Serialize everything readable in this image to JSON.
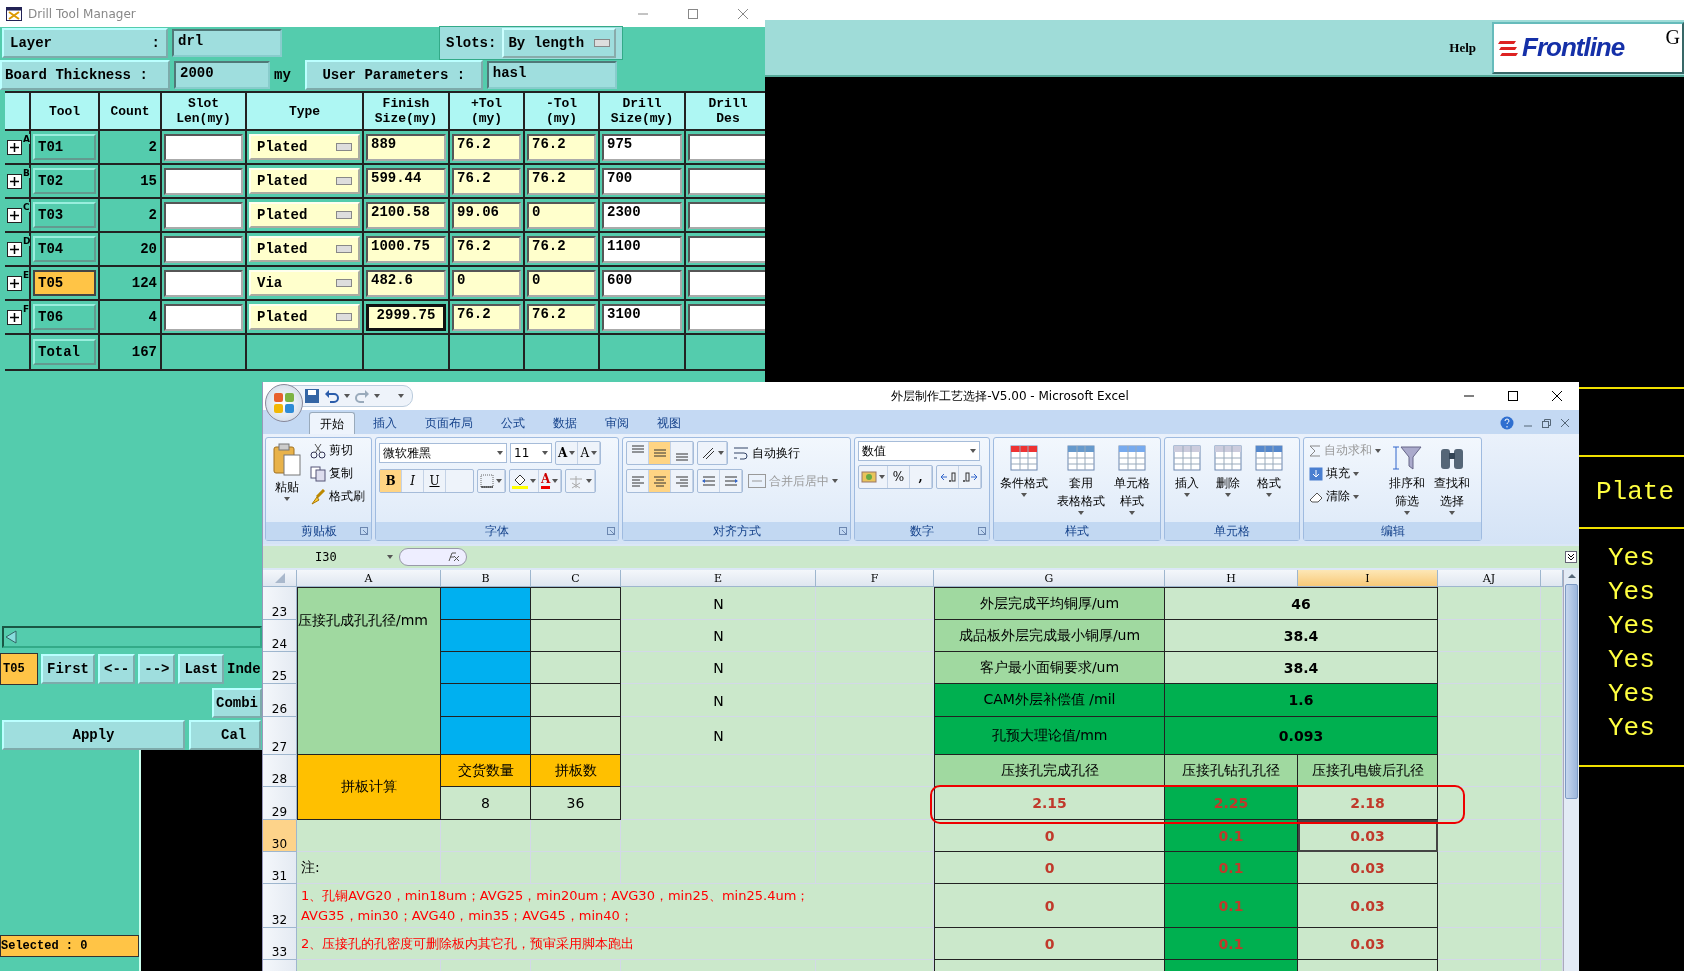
{
  "drill_tool_manager": {
    "title": "Drill Tool Manager",
    "layer": {
      "label": "Layer",
      "suffix": ":",
      "value": "drl"
    },
    "slots": {
      "label": "Slots:",
      "value": "By length"
    },
    "board_thickness": {
      "label": "Board Thickness :",
      "value": "2000",
      "unit": "my"
    },
    "user_parameters": {
      "label": "User Parameters :",
      "value": "hasl"
    },
    "columns": [
      "Tool",
      "Count",
      "Slot\nLen(my)",
      "Type",
      "Finish\nSize(my)",
      "+Tol\n(my)",
      "-Tol\n(my)",
      "Drill\nSize(my)",
      "Drill\nDes"
    ],
    "rows": [
      {
        "letter": "A",
        "tool": "T01",
        "count": "2",
        "type": "Plated",
        "finish": "889",
        "plus_tol": "76.2",
        "minus_tol": "76.2",
        "drill_size": "975",
        "selected": false,
        "focused": false
      },
      {
        "letter": "B",
        "tool": "T02",
        "count": "15",
        "type": "Plated",
        "finish": "599.44",
        "plus_tol": "76.2",
        "minus_tol": "76.2",
        "drill_size": "700",
        "selected": false,
        "focused": false
      },
      {
        "letter": "C",
        "tool": "T03",
        "count": "2",
        "type": "Plated",
        "finish": "2100.58",
        "plus_tol": "99.06",
        "minus_tol": "0",
        "drill_size": "2300",
        "selected": false,
        "focused": false
      },
      {
        "letter": "D",
        "tool": "T04",
        "count": "20",
        "type": "Plated",
        "finish": "1000.75",
        "plus_tol": "76.2",
        "minus_tol": "76.2",
        "drill_size": "1100",
        "selected": false,
        "focused": false
      },
      {
        "letter": "E",
        "tool": "T05",
        "count": "124",
        "type": "Via",
        "finish": "482.6",
        "plus_tol": "0",
        "minus_tol": "0",
        "drill_size": "600",
        "selected": true,
        "focused": false
      },
      {
        "letter": "F",
        "tool": "T06",
        "count": "4",
        "type": "Plated",
        "finish": "2999.75",
        "plus_tol": "76.2",
        "minus_tol": "76.2",
        "drill_size": "3100",
        "selected": false,
        "focused": true
      }
    ],
    "total": {
      "label": "Total",
      "count": "167"
    },
    "current_tool": "T05",
    "nav_buttons": [
      "First",
      "<--",
      "-->",
      "Last"
    ],
    "index_label": "Inde",
    "combine_button": "Combi",
    "apply_button": "Apply",
    "cancel_button": "Cal",
    "status": "Selected : 0"
  },
  "frontline": {
    "help": "Help",
    "logo": "Frontline",
    "logo_edge": "G",
    "type_value": "Plate",
    "flags": [
      "Yes",
      "Yes",
      "Yes",
      "Yes",
      "Yes",
      "Yes"
    ]
  },
  "excel": {
    "title": "外层制作工艺选择-V5.00 - Microsoft Excel",
    "tabs": [
      {
        "label": "开始",
        "selected": true
      },
      {
        "label": "插入",
        "selected": false
      },
      {
        "label": "页面布局",
        "selected": false
      },
      {
        "label": "公式",
        "selected": false
      },
      {
        "label": "数据",
        "selected": false
      },
      {
        "label": "审阅",
        "selected": false
      },
      {
        "label": "视图",
        "selected": false
      }
    ],
    "clipboard": {
      "label": "剪贴板",
      "paste": "粘贴",
      "cut": "剪切",
      "copy": "复制",
      "format_painter": "格式刷"
    },
    "font": {
      "label": "字体",
      "name": "微软雅黑",
      "size": "11",
      "grow": "A",
      "shrink": "A",
      "color_letter": "A",
      "styles": [
        {
          "label": "B",
          "on": true
        },
        {
          "label": "I",
          "on": false
        },
        {
          "label": "U",
          "on": false
        }
      ]
    },
    "alignment": {
      "label": "对齐方式",
      "wrap": "自动换行",
      "merge": {
        "label": "合并后居中",
        "disabled": true
      },
      "vertical": [
        {
          "selected": false
        },
        {
          "selected": true
        },
        {
          "selected": false
        }
      ],
      "horizontal": [
        {
          "selected": false
        },
        {
          "selected": true
        },
        {
          "selected": false
        }
      ]
    },
    "number": {
      "label": "数字",
      "format": "数值",
      "percent": "%",
      "comma": ","
    },
    "styles": {
      "label": "样式",
      "items": [
        [
          "条件格式"
        ],
        [
          "套用",
          "表格格式"
        ],
        [
          "单元格",
          "样式"
        ]
      ]
    },
    "cells": {
      "label": "单元格",
      "items": [
        "插入",
        "删除",
        "格式"
      ]
    },
    "editing": {
      "label": "编辑",
      "autosum": {
        "label": "自动求和",
        "disabled": true
      },
      "fill": "填充",
      "clear": "清除",
      "sort": [
        "排序和",
        "筛选"
      ],
      "find": [
        "查找和",
        "选择"
      ]
    },
    "name_box": "I30",
    "columns": [
      {
        "label": "A",
        "selected": false
      },
      {
        "label": "B",
        "selected": false
      },
      {
        "label": "C",
        "selected": false
      },
      {
        "label": "E",
        "selected": false
      },
      {
        "label": "F",
        "selected": false
      },
      {
        "label": "G",
        "selected": false
      },
      {
        "label": "H",
        "selected": false
      },
      {
        "label": "I",
        "selected": true
      },
      {
        "label": "AJ",
        "selected": false
      }
    ],
    "rows": [
      {
        "label": "23",
        "selected": false
      },
      {
        "label": "24",
        "selected": false
      },
      {
        "label": "25",
        "selected": false
      },
      {
        "label": "26",
        "selected": false
      },
      {
        "label": "27",
        "selected": false
      },
      {
        "label": "28",
        "selected": false
      },
      {
        "label": "29",
        "selected": false
      },
      {
        "label": "30",
        "selected": true
      },
      {
        "label": "31",
        "selected": false
      },
      {
        "label": "32",
        "selected": false
      },
      {
        "label": "33",
        "selected": false
      }
    ],
    "sheet": {
      "hole_label": "压接孔成孔孔径/mm",
      "e_values": [
        "N",
        "N",
        "N",
        "N",
        "N"
      ],
      "panel": {
        "label": "拼板计算",
        "headers": [
          "交货数量",
          "拼板数"
        ],
        "values": [
          "8",
          "36"
        ]
      },
      "params": [
        {
          "label": "外层完成平均铜厚/um",
          "value": "46",
          "highlight": false
        },
        {
          "label": "成品板外层完成最小铜厚/um",
          "value": "38.4",
          "highlight": false
        },
        {
          "label": "客户最小面铜要求/um",
          "value": "38.4",
          "highlight": false
        },
        {
          "label": "CAM外层补偿值 /mil",
          "value": "1.6",
          "highlight": true
        },
        {
          "label": "孔预大理论值/mm",
          "value": "0.093",
          "highlight": true
        }
      ],
      "hole_headers": [
        "压接孔完成孔径",
        "压接孔钻孔孔径",
        "压接孔电镀后孔径"
      ],
      "hole_rows": [
        {
          "finish": "2.15",
          "drill": "2.25",
          "plated": "2.18",
          "circled": true
        },
        {
          "finish": "0",
          "drill": "0.1",
          "plated": "0.03",
          "circled": false
        },
        {
          "finish": "0",
          "drill": "0.1",
          "plated": "0.03",
          "circled": false
        },
        {
          "finish": "0",
          "drill": "0.1",
          "plated": "0.03",
          "circled": false
        },
        {
          "finish": "0",
          "drill": "0.1",
          "plated": "0.03",
          "circled": false
        }
      ],
      "notes_title": "注:",
      "notes": [
        [
          "1、孔铜AVG20，min18um；AVG25，min20um；AVG30，min25、min25.4um；",
          "AVG35，min30；AVG40，min35；AVG45，min40；"
        ],
        [
          "2、压接孔的孔密度可删除板内其它孔，预审采用脚本跑出"
        ]
      ]
    }
  }
}
